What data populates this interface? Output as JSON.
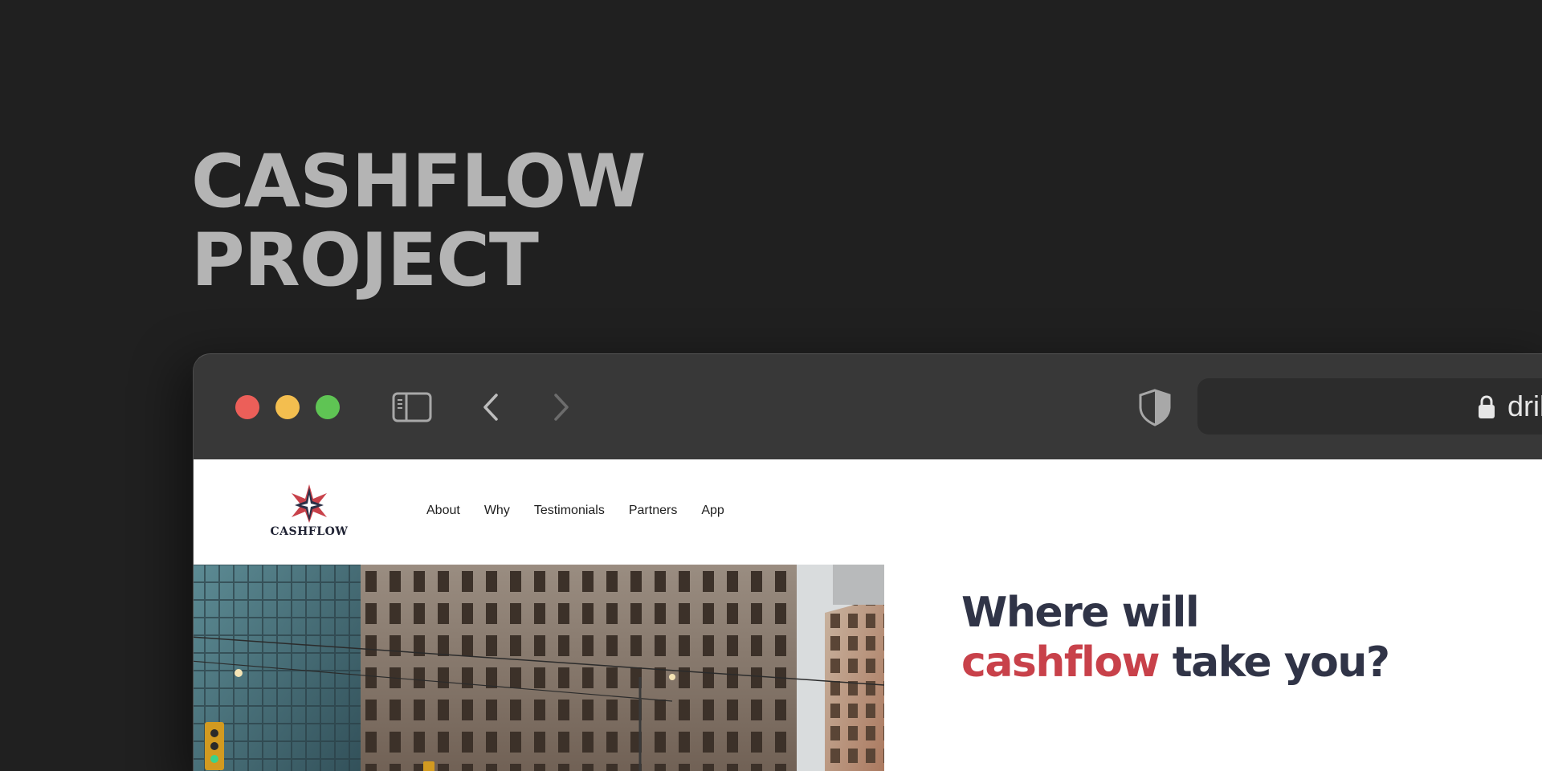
{
  "project_title": {
    "line1": "CASHFLOW",
    "line2": "PROJECT"
  },
  "browser": {
    "traffic_lights": {
      "close": "#ec5f59",
      "minimize": "#f3be4f",
      "maximize": "#5fc454"
    },
    "toolbar_icons": [
      "sidebar-icon",
      "back-icon",
      "forward-icon",
      "shield-icon"
    ],
    "address_bar": {
      "lock_icon": "lock-icon",
      "url": "dril"
    }
  },
  "site": {
    "logo_text": "CASHFLOW",
    "nav": [
      "About",
      "Why",
      "Testimonials",
      "Partners",
      "App"
    ],
    "hero": {
      "heading_line1": "Where will",
      "heading_accent": "cashflow",
      "heading_rest": " take you?",
      "accent_color": "#c8414a"
    }
  }
}
